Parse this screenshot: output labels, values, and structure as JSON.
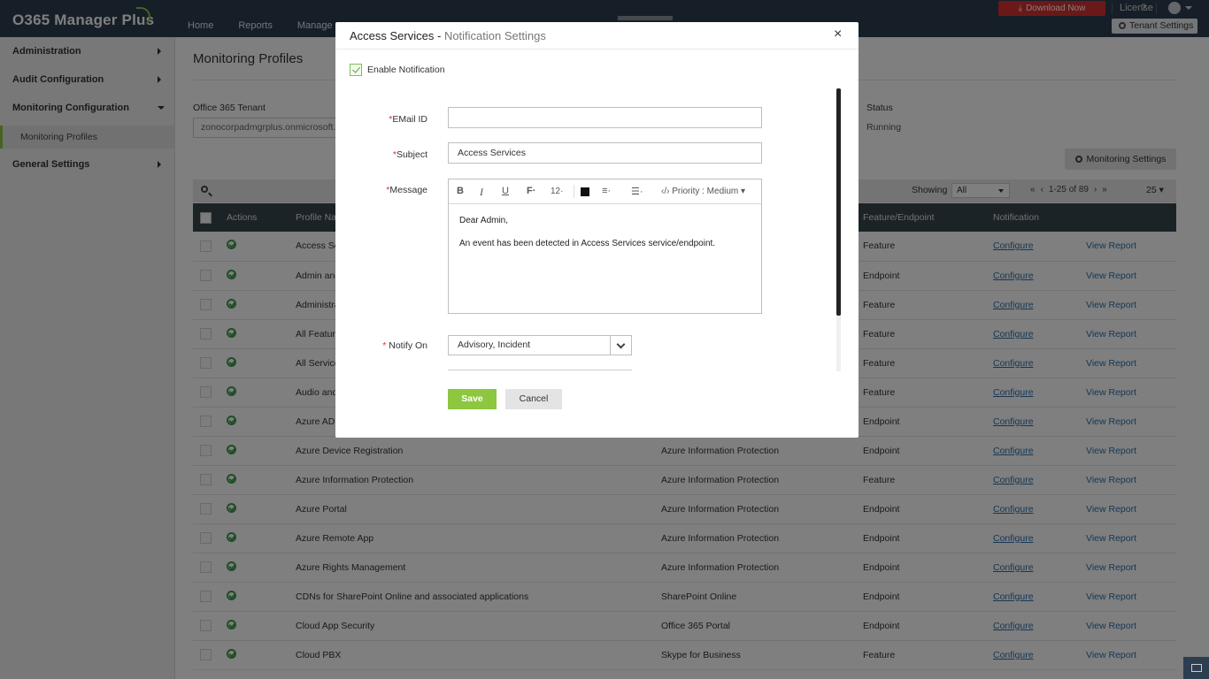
{
  "app": {
    "title": "O365 Manager Plus"
  },
  "nav": {
    "items": [
      "Home",
      "Reports",
      "Manage"
    ]
  },
  "topbar": {
    "download_label": "Download Now",
    "license_label": "License",
    "help_label": "?",
    "tenant_settings_label": "Tenant Settings"
  },
  "sidebar": {
    "items": [
      {
        "label": "Administration"
      },
      {
        "label": "Audit Configuration"
      },
      {
        "label": "Monitoring Configuration"
      },
      {
        "label": "General Settings"
      }
    ],
    "sub_item": "Monitoring Profiles"
  },
  "page": {
    "title": "Monitoring Profiles",
    "tenant_label": "Office 365 Tenant",
    "tenant_value": "zonocorpadmgrplus.onmicrosoft.com",
    "status_label": "Status",
    "status_value": "Running",
    "monitoring_settings_label": "Monitoring Settings"
  },
  "toolbar": {
    "showing_label": "Showing",
    "showing_value": "All",
    "page_range": "1-25 of 89",
    "page_size": "25"
  },
  "table": {
    "headers": [
      "Actions",
      "Profile Name",
      "Feature/Endpoint",
      "Notification"
    ],
    "rows": [
      {
        "name": "Access Services",
        "service": "",
        "type": "Feature",
        "notify": "Configure",
        "report": "View Report"
      },
      {
        "name": "Admin and Licensing",
        "service": "",
        "type": "Endpoint",
        "notify": "Configure",
        "report": "View Report"
      },
      {
        "name": "Administration",
        "service": "",
        "type": "Feature",
        "notify": "Configure",
        "report": "View Report"
      },
      {
        "name": "All Features",
        "service": "",
        "type": "Feature",
        "notify": "Configure",
        "report": "View Report"
      },
      {
        "name": "All Services",
        "service": "",
        "type": "Feature",
        "notify": "Configure",
        "report": "View Report"
      },
      {
        "name": "Audio and Video",
        "service": "",
        "type": "Feature",
        "notify": "Configure",
        "report": "View Report"
      },
      {
        "name": "Azure AD Connect",
        "service": "",
        "type": "Endpoint",
        "notify": "Configure",
        "report": "View Report"
      },
      {
        "name": "Azure Device Registration",
        "service": "Azure Information Protection",
        "type": "Endpoint",
        "notify": "Configure",
        "report": "View Report"
      },
      {
        "name": "Azure Information Protection",
        "service": "Azure Information Protection",
        "type": "Feature",
        "notify": "Configure",
        "report": "View Report"
      },
      {
        "name": "Azure Portal",
        "service": "Azure Information Protection",
        "type": "Endpoint",
        "notify": "Configure",
        "report": "View Report"
      },
      {
        "name": "Azure Remote App",
        "service": "Azure Information Protection",
        "type": "Endpoint",
        "notify": "Configure",
        "report": "View Report"
      },
      {
        "name": "Azure Rights Management",
        "service": "Azure Information Protection",
        "type": "Endpoint",
        "notify": "Configure",
        "report": "View Report"
      },
      {
        "name": "CDNs for SharePoint Online and associated applications",
        "service": "SharePoint Online",
        "type": "Endpoint",
        "notify": "Configure",
        "report": "View Report"
      },
      {
        "name": "Cloud App Security",
        "service": "Office 365 Portal",
        "type": "Endpoint",
        "notify": "Configure",
        "report": "View Report"
      },
      {
        "name": "Cloud PBX",
        "service": "Skype for Business",
        "type": "Feature",
        "notify": "Configure",
        "report": "View Report"
      }
    ]
  },
  "modal": {
    "title": "Access Services",
    "title_sep": " - ",
    "subtitle": "Notification Settings",
    "close": "×",
    "enable_label": "Enable Notification",
    "email_label": "EMail ID",
    "email_value": "",
    "subject_label": "Subject",
    "subject_value": "Access Services",
    "message_label": "Message",
    "editor": {
      "font_size": "12",
      "priority": "Priority : Medium",
      "body_line1": "Dear Admin,",
      "body_line2": "An event has been detected in Access Services service/endpoint."
    },
    "notify_label": "Notify On",
    "notify_value": "Advisory, Incident",
    "save_label": "Save",
    "cancel_label": "Cancel"
  }
}
